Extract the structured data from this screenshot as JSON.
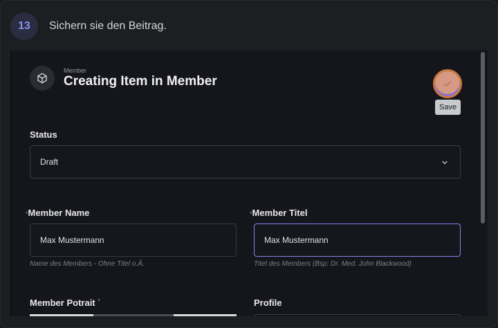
{
  "step": {
    "number": "13",
    "instruction": "Sichern sie den Beitrag."
  },
  "header": {
    "collection": "Member",
    "title": "Creating Item in Member",
    "icon": "cube-icon"
  },
  "save": {
    "tooltip": "Save",
    "icon": "check-icon"
  },
  "fields": {
    "status": {
      "label": "Status",
      "value": "Draft"
    },
    "member_name": {
      "required_mark": "*",
      "label": "Member Name",
      "value": "Max Mustermann",
      "hint": "Name des Members - Ohne Titel o.Ä."
    },
    "member_titel": {
      "required_mark": "*",
      "label": "Member Titel",
      "value": "Max Mustermann",
      "hint": "Titel des Members (Bsp: Dr. Med. John Blackwood)"
    },
    "member_potrait": {
      "label": "Member Potrait",
      "required_mark": "*"
    },
    "profile": {
      "label": "Profile"
    }
  },
  "colors": {
    "accent": "#8a80f2",
    "save_button": "#d69a82",
    "save_border": "#c9783e"
  }
}
